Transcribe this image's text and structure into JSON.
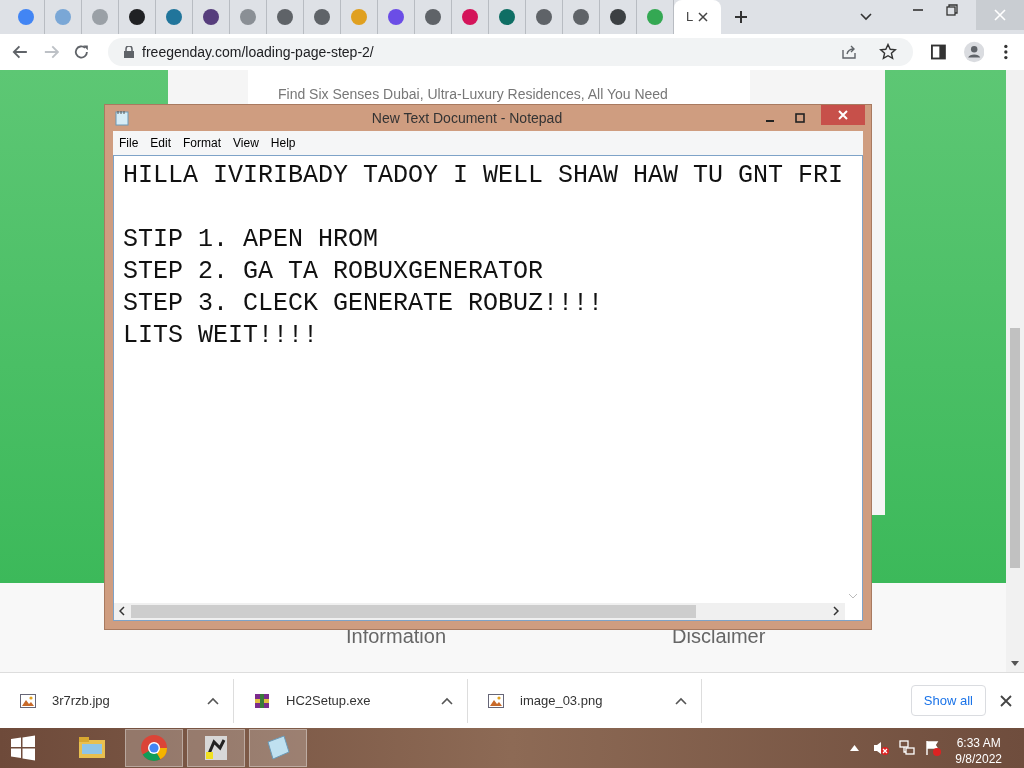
{
  "browser": {
    "tabs": [
      {
        "selected": false,
        "color": "#4285f4"
      },
      {
        "selected": false,
        "color": "#7aa7d6"
      },
      {
        "selected": false,
        "color": "#9aa0a6"
      },
      {
        "selected": false,
        "color": "#202124"
      },
      {
        "selected": false,
        "color": "#21759b"
      },
      {
        "selected": false,
        "color": "#563d7c"
      },
      {
        "selected": false,
        "color": "#8a8f95"
      },
      {
        "selected": false,
        "color": "#5f6368"
      },
      {
        "selected": false,
        "color": "#5f6368"
      },
      {
        "selected": false,
        "color": "#e0a020"
      },
      {
        "selected": false,
        "color": "#6b4de6"
      },
      {
        "selected": false,
        "color": "#5f6368"
      },
      {
        "selected": false,
        "color": "#d4145a"
      },
      {
        "selected": false,
        "color": "#0f6e64"
      },
      {
        "selected": false,
        "color": "#5f6368"
      },
      {
        "selected": false,
        "color": "#5f6368"
      },
      {
        "selected": false,
        "color": "#3c4043"
      },
      {
        "selected": false,
        "color": "#34a853"
      },
      {
        "label": "L",
        "selected": true
      }
    ],
    "url": "freegenday.com/loading-page-step-2/"
  },
  "page": {
    "intro": "Find Six Senses Dubai, Ultra-Luxury Residences, All You Need",
    "footer_headings": [
      "Information",
      "Disclaimer"
    ]
  },
  "notepad": {
    "title": "New Text Document - Notepad",
    "menu": [
      "File",
      "Edit",
      "Format",
      "View",
      "Help"
    ],
    "text": "HILLA IVIRIBADY TADOY I WELL SHAW HAW TU GNT FRI\n\nSTIP 1. APEN HROM\nSTEP 2. GA TA ROBUXGENERATOR\nSTEP 3. CLECK GENERATE ROBUZ!!!!\nLITS WEIT!!!!"
  },
  "downloads": {
    "items": [
      {
        "name": "3r7rzb.jpg",
        "kind": "image"
      },
      {
        "name": "HC2Setup.exe",
        "kind": "installer"
      },
      {
        "name": "image_03.png",
        "kind": "image"
      }
    ],
    "show_all": "Show all"
  },
  "taskbar": {
    "apps": [
      {
        "kind": "explorer",
        "selected": false
      },
      {
        "kind": "chrome",
        "selected": true
      },
      {
        "kind": "app",
        "selected": true
      },
      {
        "kind": "notepad",
        "selected": true
      }
    ],
    "time": "6:33 AM",
    "date": "9/8/2022"
  }
}
